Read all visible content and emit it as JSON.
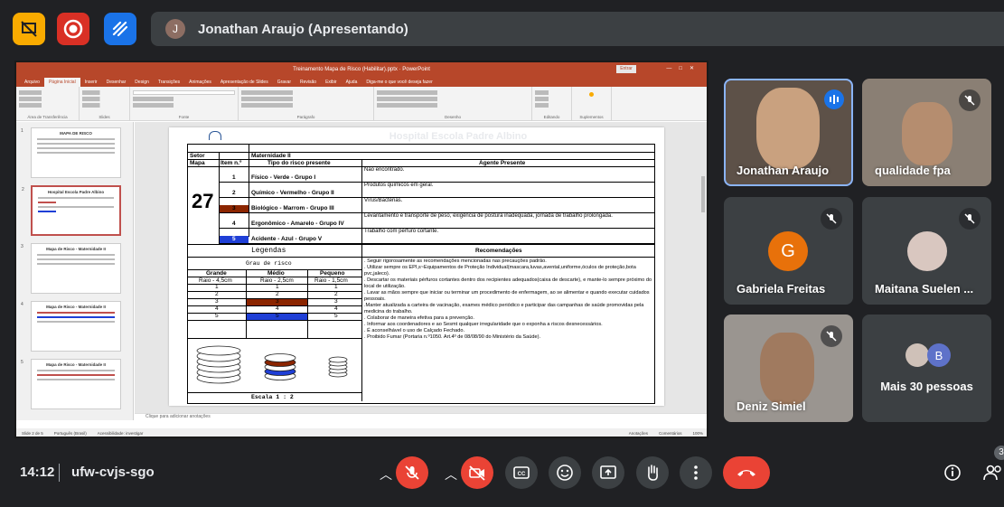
{
  "top": {
    "presenter_initial": "J",
    "presenter_label": "Jonathan Araujo (Apresentando)"
  },
  "ppt": {
    "title": "Treinamento Mapa de Risco (Habilitar).pptx  ·  PowerPoint",
    "share_label": "Entrar",
    "tabs": [
      "Arquivo",
      "Página Inicial",
      "Inserir",
      "Desenhar",
      "Design",
      "Transições",
      "Animações",
      "Apresentação de Slides",
      "Gravar",
      "Revisão",
      "Exibir",
      "Ajuda",
      "Diga-me o que você deseja fazer"
    ],
    "groups": [
      "Área de Transferência",
      "Slides",
      "Fonte",
      "Parágrafo",
      "Desenho",
      "Editando",
      "Suplementos"
    ],
    "notes_placeholder": "Clique para adicionar anotações",
    "status_left": "Slide 2 de 5",
    "status_lang": "Português (Brasil)",
    "status_access": "Acessibilidade: investigar",
    "status_notes": "Anotações",
    "status_comments": "Comentários",
    "status_zoom": "100%"
  },
  "slide": {
    "title": "Hospital Escola Padre Albino",
    "setor_label": "Setor",
    "setor_value": "Maternidade II",
    "mapa_label": "Mapa",
    "item_label": "Item n.º",
    "tipo_header": "Tipo do risco presente",
    "agente_header": "Agente Presente",
    "mapa_number": "27",
    "risks": [
      {
        "n": "1",
        "tipo": "Físico - Verde - Grupo I",
        "agente": "Não encontrado."
      },
      {
        "n": "2",
        "tipo": "Químico - Vermelho - Grupo II",
        "agente": "Produtos químicos em geral."
      },
      {
        "n": "3",
        "tipo": "Biológico - Marrom - Grupo III",
        "agente": "Vírus/Bactérias."
      },
      {
        "n": "4",
        "tipo": "Ergonômico - Amarelo - Grupo IV",
        "agente": "Levantamento e transporte de peso, exigência de postura inadequada, jornada de trabalho prolongada."
      },
      {
        "n": "5",
        "tipo": "Acidente - Azul - Grupo V",
        "agente": "Trabalho com pérfuro cortante."
      }
    ],
    "legendas": "Legendas",
    "grau": "Grau de risco",
    "grande": "Grande",
    "medio": "Médio",
    "pequeno": "Pequeno",
    "raio_g": "Raio - 4,5cm",
    "raio_m": "Raio - 2,5cm",
    "raio_p": "Raio - 1,5cm",
    "grade_rows": [
      "1",
      "2",
      "3",
      "4",
      "5"
    ],
    "escala": "Escala 1 : 2",
    "recomendacoes_header": "Recomendações",
    "recomendacoes": [
      ". Seguir rigorosamente as recomendações mencionadas nas precauções padrão.",
      ". Utilizar sempre os EPI,s~Equipamentos de Proteção Individual(mascara,luvas,avental,uniforme,óculos de proteção,bota pvc,jaleco).",
      ". Descartar os materiais pérfuros cortantes dentro dos recipientes adequados(caixa de descarte), e mante-lo sempre próximo do local de utilização.",
      ". Lavar as mãos sempre que iniciar ou terminar um procedimento de enfermagem,  ao se alimentar e quando executar cuidados pessoais.",
      ".Manter atualizada a carteira de vacinação, exames médico periódico e participar das campanhas de saúde promovidas pela medicina do trabalho.",
      ". Colaborar de maneira efetiva para a prevenção.",
      ". Informar aos coordenadores e ao Sesmt qualquer irregularidade que o exponha a riscos desnecessários.",
      ". É aconselhável o uso de Calçado Fechado.",
      ". Proibido Fumar (Portaria n.º1050. Art.4º de 08/08/90 do Ministério da Saúde)."
    ]
  },
  "thumbs": [
    {
      "n": "1",
      "title": "MAPA DE RISCO"
    },
    {
      "n": "2",
      "title": "Hospital Escola Padre Albino"
    },
    {
      "n": "3",
      "title": "Mapa de Risco - Maternidade II"
    },
    {
      "n": "4",
      "title": "Mapa de Risco - Maternidade II"
    },
    {
      "n": "5",
      "title": "Mapa de Risco - Maternidade II"
    }
  ],
  "participants": [
    {
      "name": "Jonathan Araujo"
    },
    {
      "name": "qualidade fpa"
    },
    {
      "name": "Gabriela Freitas",
      "initial": "G"
    },
    {
      "name": "Maitana Suelen ..."
    },
    {
      "name": "Deniz Simiel"
    },
    {
      "name": "Mais 30 pessoas",
      "initial": "B"
    }
  ],
  "bottom": {
    "time": "14:12",
    "meeting_code": "ufw-cvjs-sgo",
    "people_count": "3"
  },
  "colors": {
    "meet_bg": "#202124",
    "tile_bg": "#3c4043",
    "red": "#ea4335",
    "ppt_red": "#b7472a",
    "active_blue": "#8ab4f8"
  }
}
